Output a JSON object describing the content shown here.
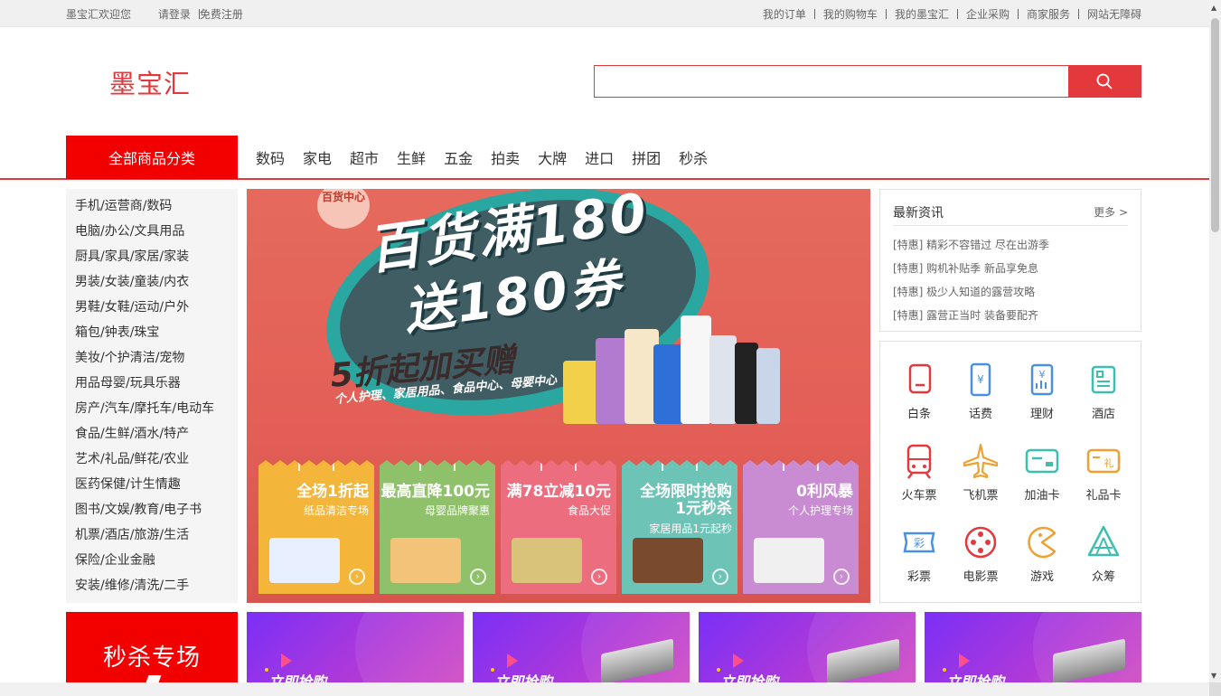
{
  "topbar": {
    "welcome": "墨宝汇欢迎您",
    "login": "请登录",
    "register": "免费注册",
    "links": [
      "我的订单",
      "我的购物车",
      "我的墨宝汇",
      "企业采购",
      "商家服务",
      "网站无障碍"
    ]
  },
  "header": {
    "logo": "墨宝汇",
    "search_placeholder": "",
    "search_icon": "search-icon"
  },
  "nav": {
    "all_categories": "全部商品分类",
    "links": [
      "数码",
      "家电",
      "超市",
      "生鲜",
      "五金",
      "拍卖",
      "大牌",
      "进口",
      "拼团",
      "秒杀"
    ]
  },
  "categories": [
    "手机/运营商/数码",
    "电脑/办公/文具用品",
    "厨具/家具/家居/家装",
    "男装/女装/童装/内衣",
    "男鞋/女鞋/运动/户外",
    "箱包/钟表/珠宝",
    "美妆/个护清洁/宠物",
    "用品母婴/玩具乐器",
    "房产/汽车/摩托车/电动车",
    "食品/生鲜/酒水/特产",
    "艺术/礼品/鲜花/农业",
    "医药保健/计生情趣",
    "图书/文娱/教育/电子书",
    "机票/酒店/旅游/生活",
    "保险/企业金融",
    "安装/维修/清洗/二手"
  ],
  "banner": {
    "stamp": "百货中心",
    "headline1": "百货满180",
    "headline2": "送180券",
    "sub": "5折起加买赠",
    "tagline": "个人护理、家居用品、食品中心、母婴中心",
    "tiles": [
      {
        "title": "全场1折起",
        "sub": "纸品清洁专场",
        "color": "#f3b63a"
      },
      {
        "title": "最高直降100元",
        "sub": "母婴品牌聚惠",
        "color": "#8fc16a"
      },
      {
        "title": "满78立减10元",
        "sub": "食品大促",
        "color": "#ec6d7d"
      },
      {
        "title": "全场限时抢购\n1元秒杀",
        "sub": "家居用品1元起秒",
        "color": "#6cc3b6"
      },
      {
        "title": "0利风暴",
        "sub": "个人护理专场",
        "color": "#c98bd2"
      }
    ]
  },
  "news": {
    "title": "最新资讯",
    "more": "更多 >",
    "items": [
      "[特惠] 精彩不容错过 尽在出游季",
      "[特惠] 购机补贴季 新品享免息",
      "[特惠] 极少人知道的露营攻略",
      "[特惠] 露营正当时 装备要配齐"
    ]
  },
  "services": [
    {
      "label": "白条",
      "icon": "ious-icon",
      "color": "#e4393c"
    },
    {
      "label": "话费",
      "icon": "phone-icon",
      "color": "#4a90e2"
    },
    {
      "label": "理财",
      "icon": "finance-icon",
      "color": "#4a90e2"
    },
    {
      "label": "酒店",
      "icon": "hotel-icon",
      "color": "#3dbfb0"
    },
    {
      "label": "火车票",
      "icon": "train-icon",
      "color": "#e4393c"
    },
    {
      "label": "飞机票",
      "icon": "plane-icon",
      "color": "#f0a030"
    },
    {
      "label": "加油卡",
      "icon": "fuel-card-icon",
      "color": "#3dbfb0"
    },
    {
      "label": "礼品卡",
      "icon": "gift-card-icon",
      "color": "#f0a030"
    },
    {
      "label": "彩票",
      "icon": "lottery-icon",
      "color": "#4a90e2"
    },
    {
      "label": "电影票",
      "icon": "movie-icon",
      "color": "#e4393c"
    },
    {
      "label": "游戏",
      "icon": "game-icon",
      "color": "#f0a030"
    },
    {
      "label": "众筹",
      "icon": "crowdfunding-icon",
      "color": "#3dbfb0"
    }
  ],
  "seckill": {
    "title": "秒杀专场"
  },
  "promos": [
    {
      "label": "立即抢购"
    },
    {
      "label": "立即抢购"
    },
    {
      "label": "立即抢购"
    },
    {
      "label": "立即抢购"
    }
  ],
  "colors": {
    "brand": "#e4393c",
    "nav_red": "#f20000"
  }
}
